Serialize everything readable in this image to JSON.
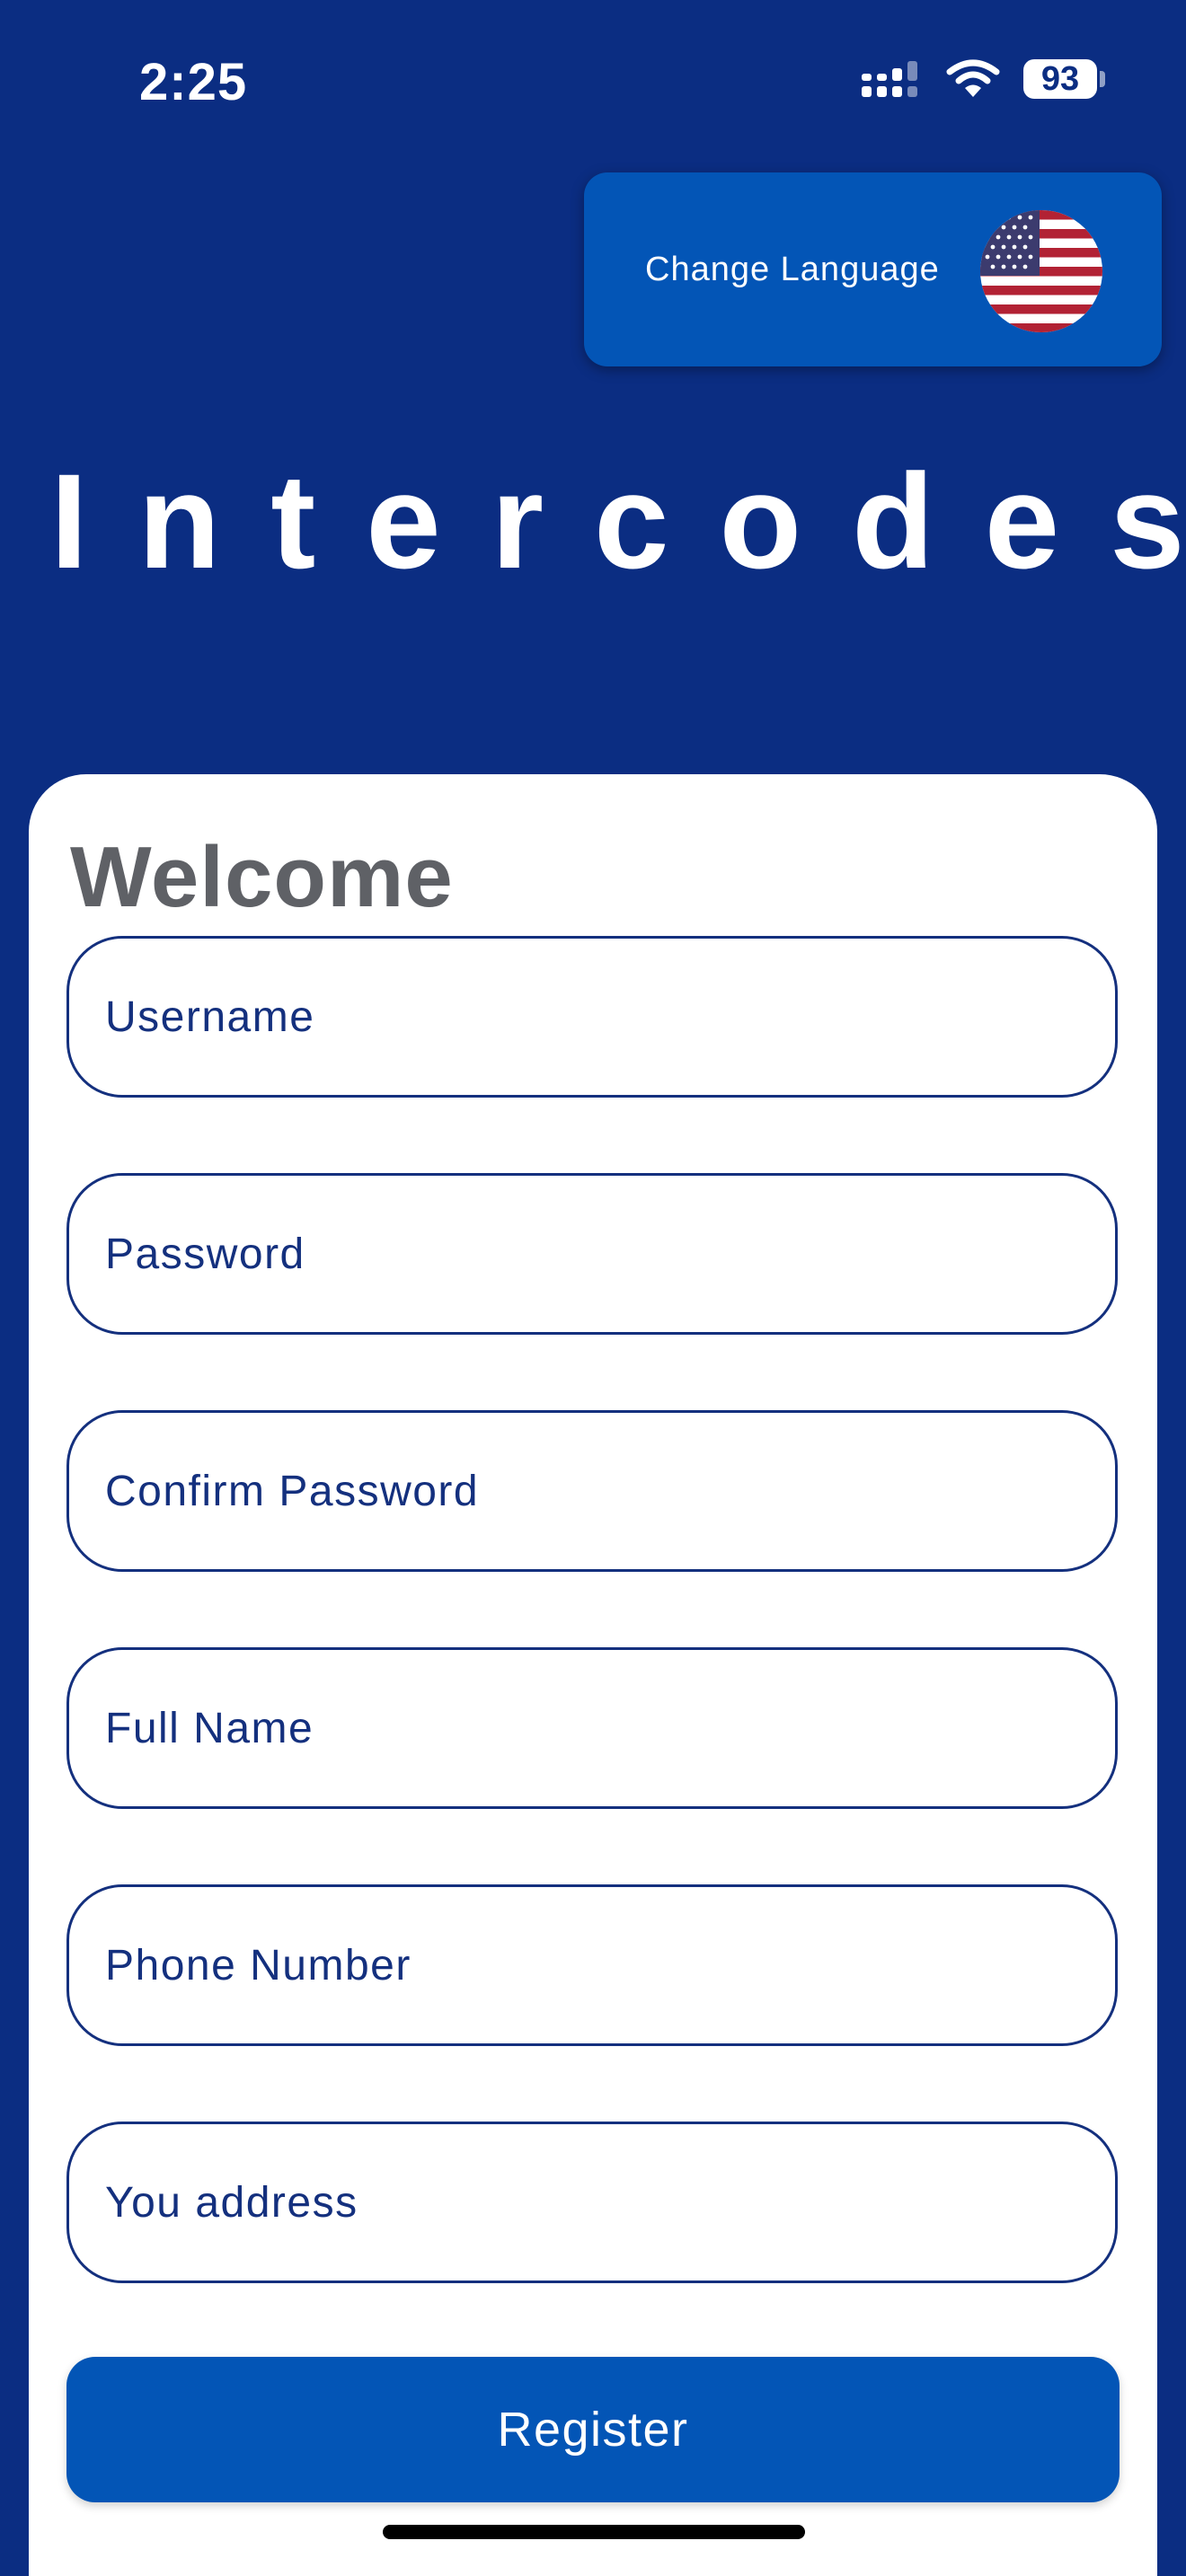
{
  "status_bar": {
    "time": "2:25",
    "battery": "93",
    "icons": [
      "signal-icon",
      "wifi-icon",
      "battery-icon"
    ]
  },
  "language_button": {
    "label": "Change Language",
    "flag_icon": "us-flag-icon"
  },
  "app": {
    "title": "Intercodes"
  },
  "form": {
    "heading": "Welcome",
    "fields": [
      {
        "name": "username",
        "placeholder": "Username",
        "value": ""
      },
      {
        "name": "password",
        "placeholder": "Password",
        "value": ""
      },
      {
        "name": "confirm_password",
        "placeholder": "Confirm Password",
        "value": ""
      },
      {
        "name": "full_name",
        "placeholder": "Full Name",
        "value": ""
      },
      {
        "name": "phone_number",
        "placeholder": "Phone Number",
        "value": ""
      },
      {
        "name": "address",
        "placeholder": "You address",
        "value": ""
      }
    ],
    "submit_label": "Register"
  },
  "colors": {
    "background": "#0b2d82",
    "accent": "#0355b6",
    "field_border": "#14307e",
    "heading_text": "#5f6166",
    "card": "#ffffff"
  }
}
